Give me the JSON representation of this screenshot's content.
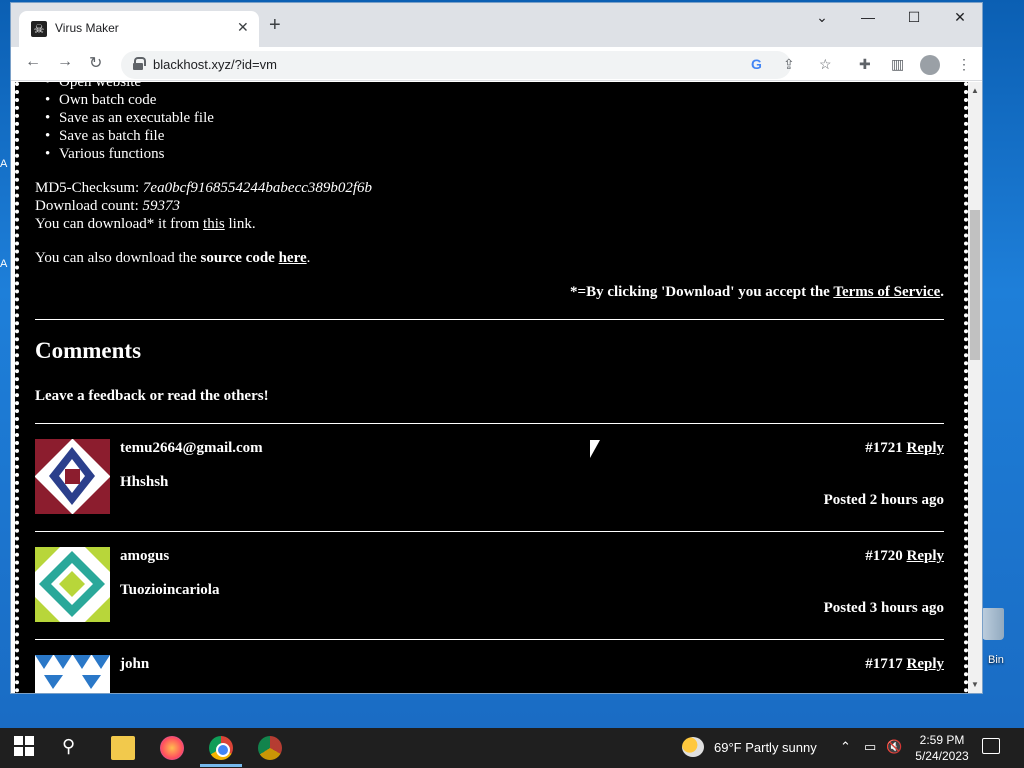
{
  "desktop": {
    "left_text_1": "A",
    "left_text_2": "A",
    "recycle_label": "Bin"
  },
  "browser": {
    "tab_title": "Virus Maker",
    "url": "blackhost.xyz/?id=vm",
    "window_controls": {
      "minimize": "—",
      "maximize": "☐",
      "close": "✕",
      "dropdown": "⌄"
    }
  },
  "page": {
    "features": [
      "Open website",
      "Own batch code",
      "Save as an executable file",
      "Save as batch file",
      "Various functions"
    ],
    "md5_label": "MD5-Checksum: ",
    "md5_value": "7ea0bcf9168554244babecc389b02f6b",
    "download_count_label": "Download count: ",
    "download_count_value": "59373",
    "download_prefix": "You can download* it from ",
    "download_link": "this",
    "download_suffix": " link.",
    "source_prefix": "You can also download the ",
    "source_bold": "source code",
    "source_link": "here",
    "source_suffix": ".",
    "tos_prefix": "*=By clicking 'Download' you accept the ",
    "tos_link": "Terms of Service",
    "tos_suffix": ".",
    "comments_heading": "Comments",
    "comments_sub": "Leave a feedback or read the others!",
    "comments": [
      {
        "author": "temu2664@gmail.com",
        "id": "#1721",
        "reply": "Reply",
        "text": "Hhshsh",
        "posted": "Posted 2 hours ago"
      },
      {
        "author": "amogus",
        "id": "#1720",
        "reply": "Reply",
        "text": "Tuozioincariola",
        "posted": "Posted 3 hours ago"
      },
      {
        "author": "john",
        "id": "#1717",
        "reply": "Reply",
        "text": "",
        "posted": ""
      }
    ]
  },
  "taskbar": {
    "weather": "69°F  Partly sunny",
    "time": "2:59 PM",
    "date": "5/24/2023"
  }
}
